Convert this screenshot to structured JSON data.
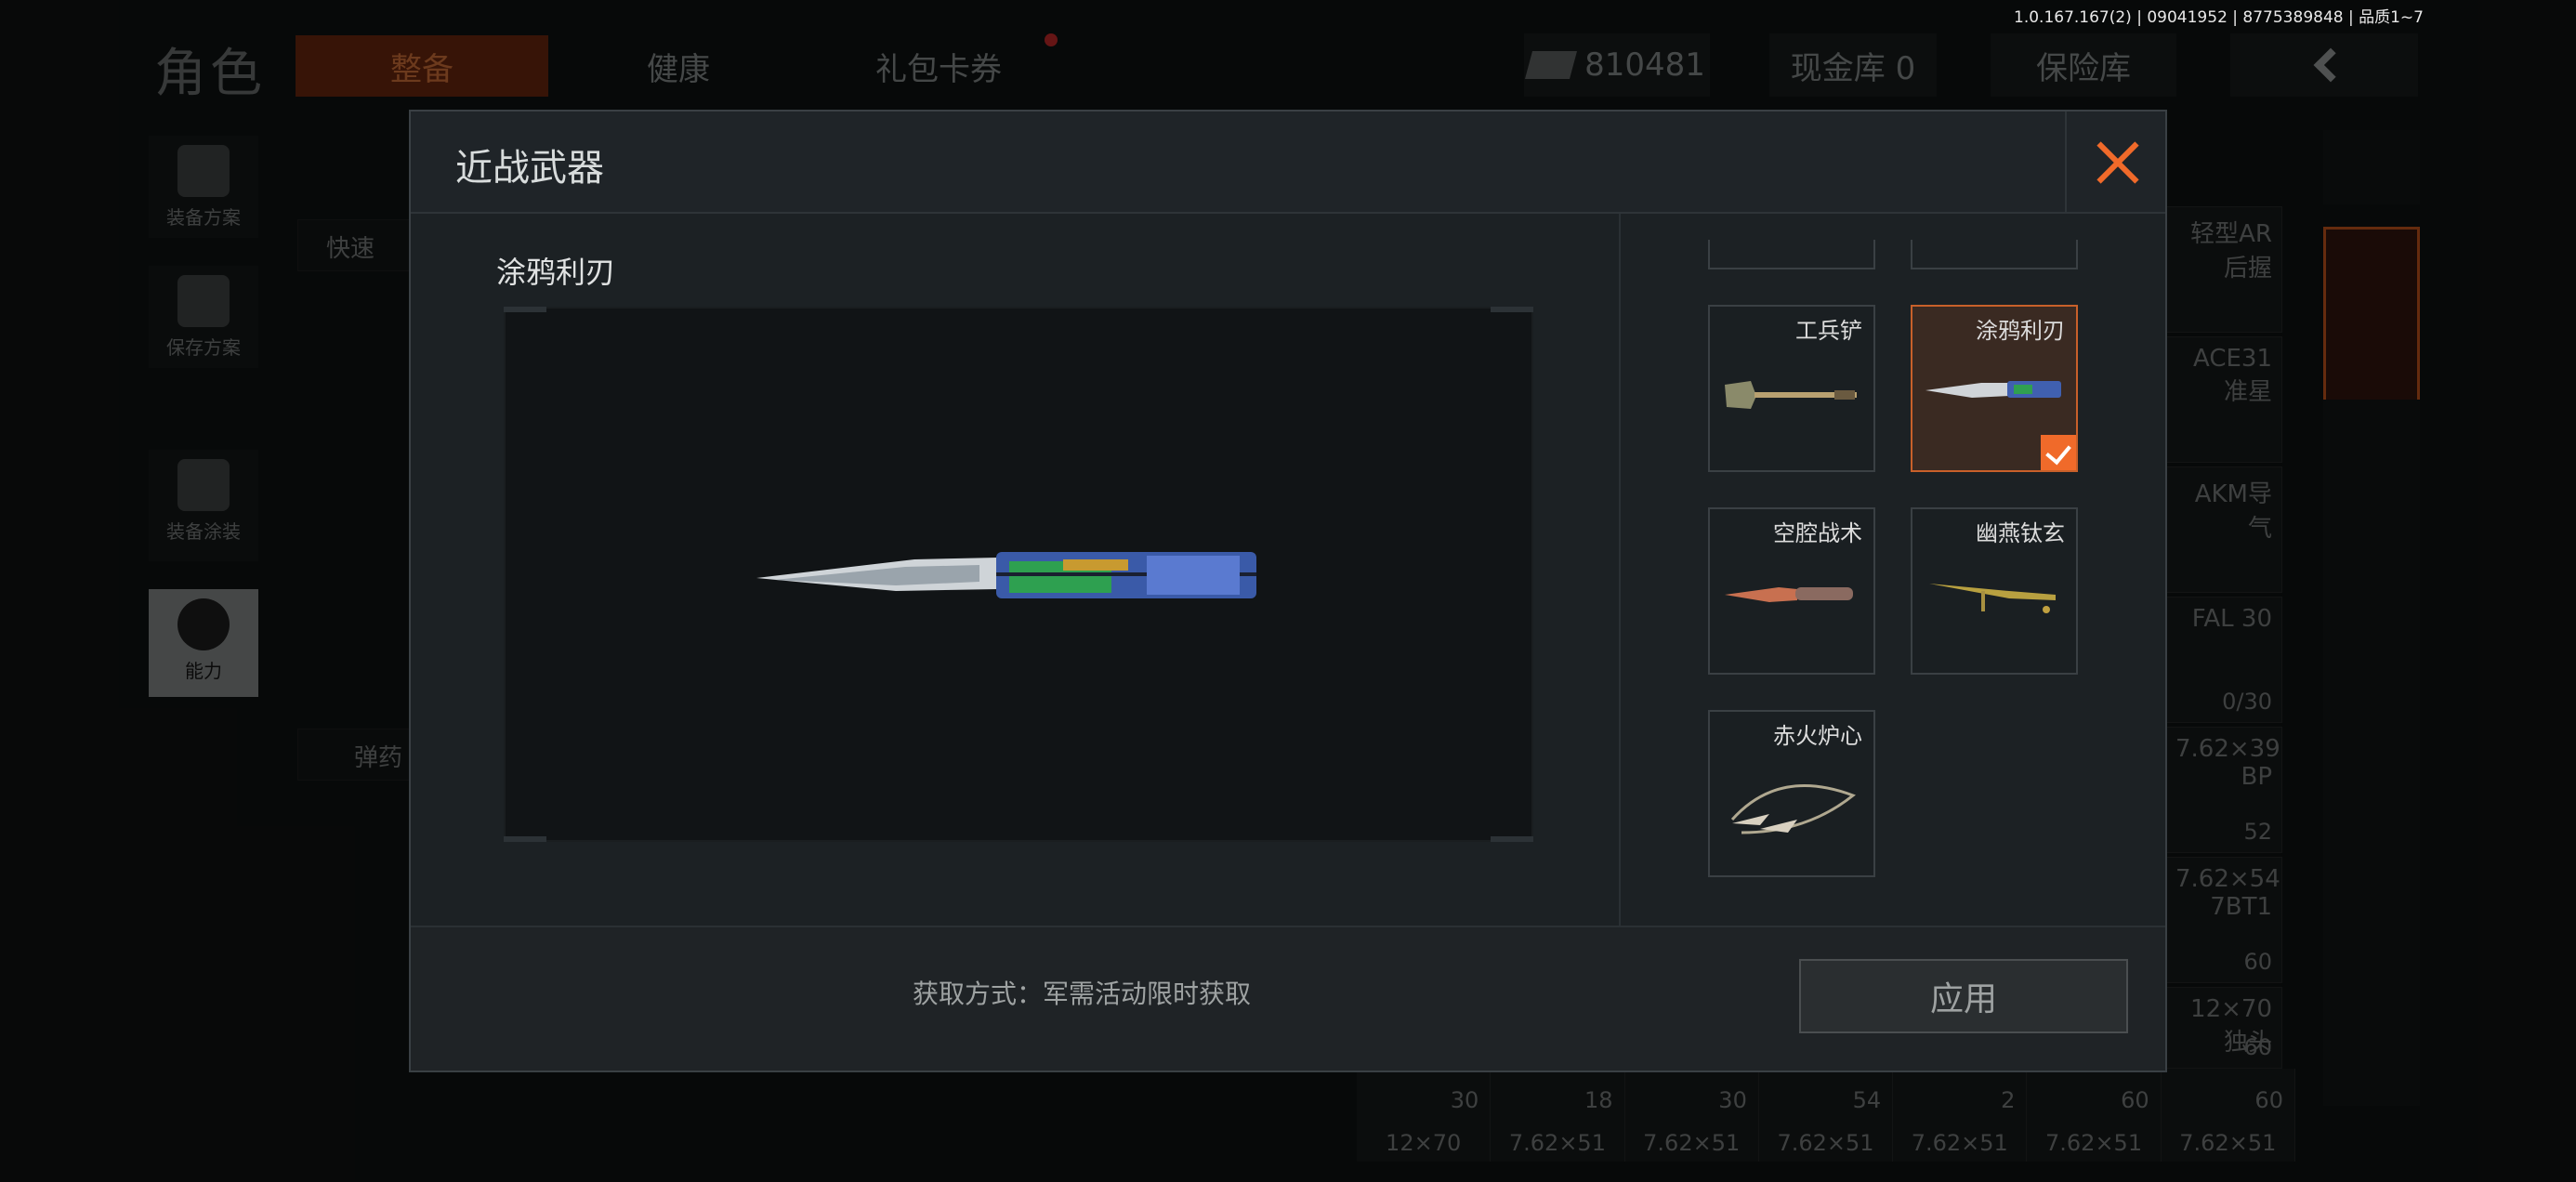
{
  "version": "1.0.167.167(2) | 09041952 | 8775389848 | 品质1~7",
  "background": {
    "title": "角色",
    "tabs": [
      "整备",
      "健康",
      "礼包卡券"
    ],
    "money": "810481",
    "cash_vault": "现金库 0",
    "safe": "保险库",
    "left_items": [
      "装备方案",
      "保存方案",
      "装备涂装",
      "能力"
    ],
    "left_buttons": [
      "快速",
      "弹药"
    ],
    "inventory": [
      {
        "label": "轻型AR后握",
        "num": ""
      },
      {
        "label": "ACE31准星",
        "num": ""
      },
      {
        "label": "AKM导气",
        "num": ""
      },
      {
        "label": "FAL 30",
        "num": "0/30"
      },
      {
        "label": "7.62×39 BP",
        "num": "52"
      },
      {
        "label": "7.62×54 7BT1",
        "num": "60"
      },
      {
        "label": "12×70 独头",
        "num": "60"
      }
    ],
    "ammo": [
      {
        "count": "30",
        "caliber": "12×70"
      },
      {
        "count": "18",
        "caliber": "7.62×51"
      },
      {
        "count": "30",
        "caliber": "7.62×51"
      },
      {
        "count": "54",
        "caliber": "7.62×51"
      },
      {
        "count": "2",
        "caliber": "7.62×51"
      },
      {
        "count": "60",
        "caliber": "7.62×51"
      },
      {
        "count": "60",
        "caliber": "7.62×51"
      }
    ]
  },
  "modal": {
    "title": "近战武器",
    "selected_name": "涂鸦利刃",
    "items": [
      {
        "label": "工兵铲",
        "selected": false
      },
      {
        "label": "涂鸦利刃",
        "selected": true
      },
      {
        "label": "空腔战术",
        "selected": false
      },
      {
        "label": "幽燕钛玄",
        "selected": false
      },
      {
        "label": "赤火炉心",
        "selected": false
      }
    ],
    "acquire_text": "获取方式：军需活动限时获取",
    "apply_label": "应用"
  },
  "colors": {
    "accent": "#f06a2a",
    "selected_bg": "#3a2a22"
  }
}
